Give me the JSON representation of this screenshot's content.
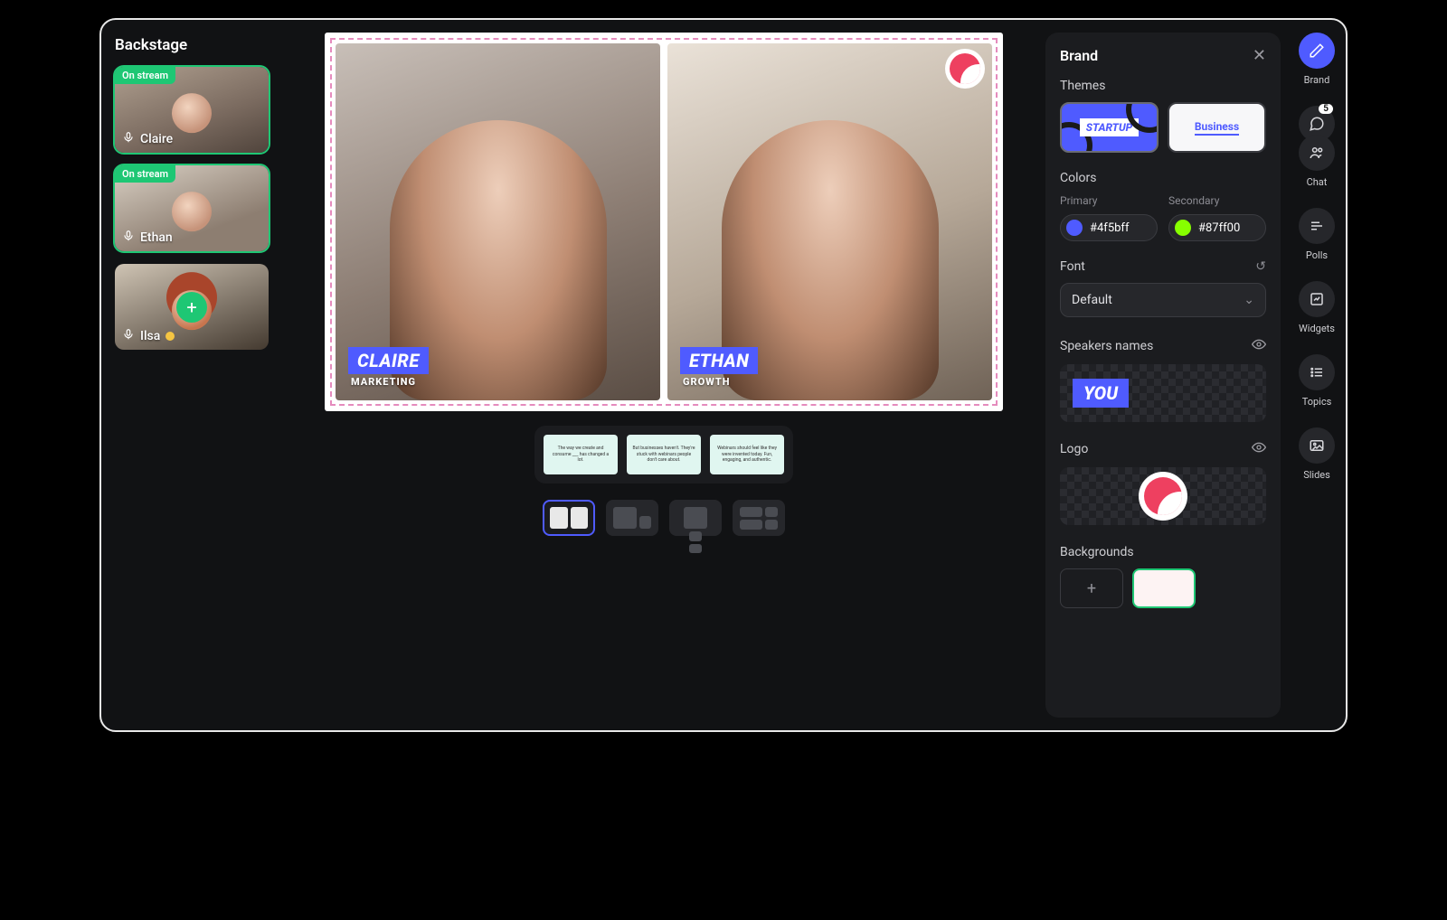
{
  "backstage": {
    "title": "Backstage",
    "on_stream_badge": "On stream",
    "participants": [
      {
        "name": "Claire",
        "on_stream": true
      },
      {
        "name": "Ethan",
        "on_stream": true
      },
      {
        "name": "Ilsa",
        "on_stream": false
      }
    ]
  },
  "stage": {
    "speakers": [
      {
        "name": "CLAIRE",
        "role": "MARKETING"
      },
      {
        "name": "ETHAN",
        "role": "GROWTH"
      }
    ],
    "slides": [
      {
        "text": "The way we create and consume ___ has changed a lot."
      },
      {
        "text": "But businesses haven't. They're stuck with webinars people don't care about."
      },
      {
        "text": "Webinars should feel like they were invented today. Fun, engaging, and authentic."
      }
    ]
  },
  "brand": {
    "title": "Brand",
    "sections": {
      "themes": "Themes",
      "colors": "Colors",
      "font": "Font",
      "speakers": "Speakers names",
      "logo": "Logo",
      "backgrounds": "Backgrounds"
    },
    "themes": {
      "startup": "STARTUP",
      "business": "Business"
    },
    "colors": {
      "primary_label": "Primary",
      "secondary_label": "Secondary",
      "primary": "#4f5bff",
      "secondary": "#87ff00"
    },
    "font_value": "Default",
    "speaker_preview": "YOU"
  },
  "rail": {
    "brand": "Brand",
    "chat": "Chat",
    "chat_badge": "5",
    "polls": "Polls",
    "widgets": "Widgets",
    "topics": "Topics",
    "slides": "Slides"
  }
}
